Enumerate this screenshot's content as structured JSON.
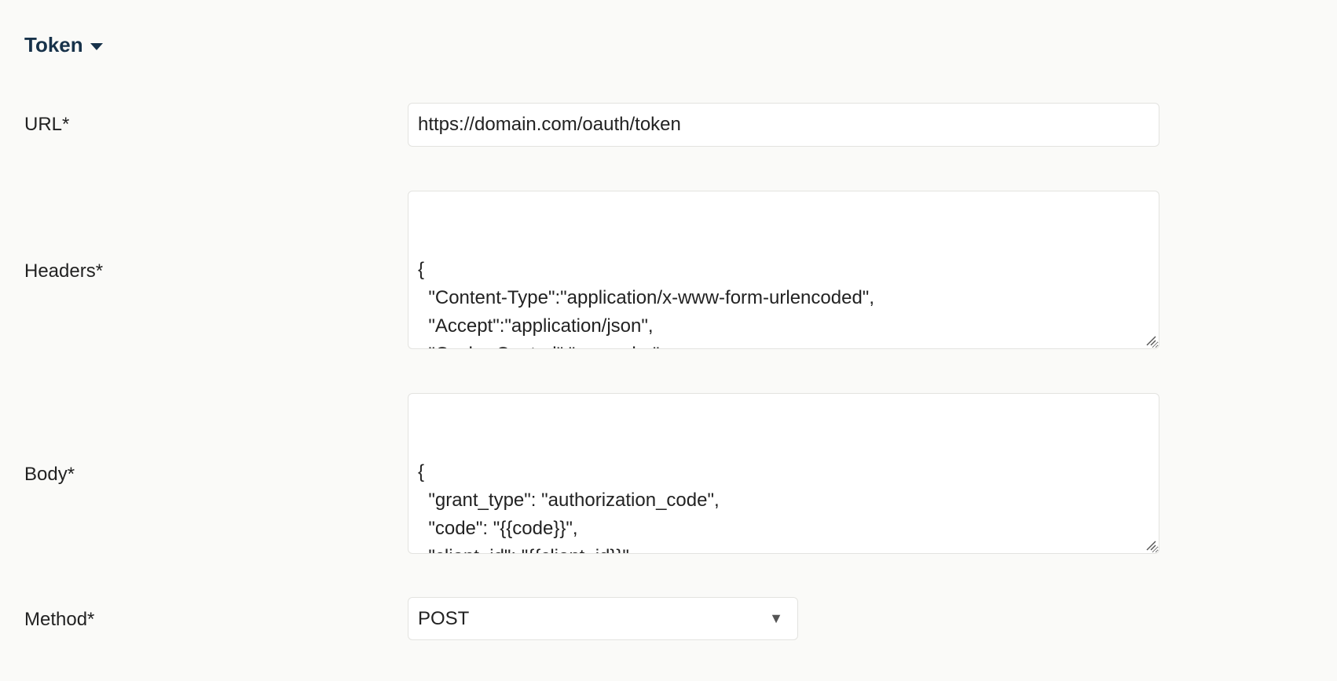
{
  "section": {
    "title": "Token"
  },
  "url": {
    "label": "URL*",
    "value": "https://domain.com/oauth/token"
  },
  "headers": {
    "label": "Headers*",
    "value": "{\n  \"Content-Type\":\"application/x-www-form-urlencoded\",\n  \"Accept\":\"application/json\",\n  \"Cache-Control\":\"no-cache\"\n}"
  },
  "body": {
    "label": "Body*",
    "value": "{\n  \"grant_type\": \"authorization_code\",\n  \"code\": \"{{code}}\",\n  \"client_id\": \"{{client_id}}\",\n  \"client_secret\": \"{{client_secret}}\",\n  \"redirect_uri\": \"{{redirect_uri}}\"\n}"
  },
  "method": {
    "label": "Method*",
    "selected": "POST",
    "arrow_icon": "triangle-down-icon"
  },
  "colors": {
    "background": "#fafaf8",
    "header_text": "#17324a",
    "field_border": "#e3e3e0"
  }
}
